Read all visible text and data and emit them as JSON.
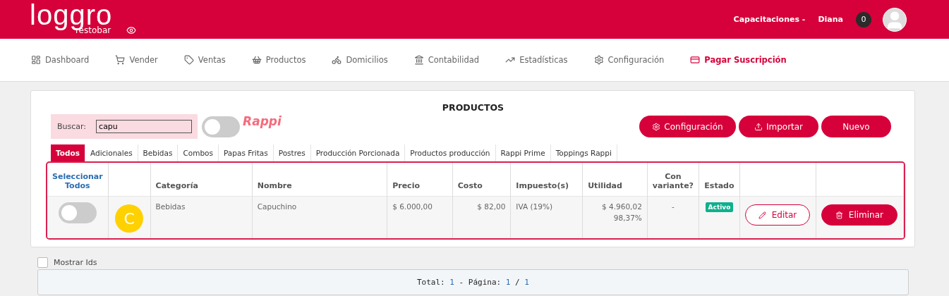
{
  "header": {
    "logo": "loggro",
    "logo_sub": "restobar",
    "company": "Capacitaciones -",
    "user": "Diana",
    "notifications": "0"
  },
  "nav": [
    {
      "label": "Dashboard",
      "selected": false
    },
    {
      "label": "Vender",
      "selected": false
    },
    {
      "label": "Ventas",
      "selected": false
    },
    {
      "label": "Productos",
      "selected": false
    },
    {
      "label": "Domicilios",
      "selected": false
    },
    {
      "label": "Contabilidad",
      "selected": false
    },
    {
      "label": "Estadísticas",
      "selected": false
    },
    {
      "label": "Configuración",
      "selected": false
    },
    {
      "label": "Pagar Suscripción",
      "selected": true
    }
  ],
  "title": "PRODUCTOS",
  "search": {
    "label": "Buscar:",
    "value": "capu"
  },
  "rappi": {
    "label": "Rappi",
    "on": false
  },
  "buttons": [
    "Configuración",
    "Importar",
    "Nuevo"
  ],
  "tabs": [
    {
      "label": "Todos",
      "selected": true
    },
    {
      "label": "Adicionales",
      "selected": false
    },
    {
      "label": "Bebidas",
      "selected": false
    },
    {
      "label": "Combos",
      "selected": false
    },
    {
      "label": "Papas Fritas",
      "selected": false
    },
    {
      "label": "Postres",
      "selected": false
    },
    {
      "label": "Producción Porcionada",
      "selected": false
    },
    {
      "label": "Productos producción",
      "selected": false
    },
    {
      "label": "Rappi Prime",
      "selected": false
    },
    {
      "label": "Toppings Rappi",
      "selected": false
    }
  ],
  "table": {
    "columns": [
      "Seleccionar Todos",
      "",
      "Categoría",
      "Nombre",
      "Precio",
      "Costo",
      "Impuesto(s)",
      "Utilidad",
      "Con variante?",
      "Estado",
      "",
      ""
    ],
    "rows": [
      {
        "selected": false,
        "initial": "C",
        "category": "Bebidas",
        "name": "Capuchino",
        "price": "$ 6.000,00",
        "cost": "$ 82,00",
        "tax": "IVA (19%)",
        "profit": "$ 4.960,02",
        "profit_pct": "98,37%",
        "variant": "-",
        "status": "Activo",
        "edit": "Editar",
        "delete": "Eliminar"
      }
    ]
  },
  "show_ids": {
    "label": "Mostrar Ids",
    "checked": false
  },
  "pagination": [
    {
      "text": "Total:",
      "value": false
    },
    {
      "text": "1",
      "value": true
    },
    {
      "text": "- Página:",
      "value": false
    },
    {
      "text": "1",
      "value": true
    },
    {
      "text": "/",
      "value": false
    },
    {
      "text": "1",
      "value": true
    }
  ]
}
